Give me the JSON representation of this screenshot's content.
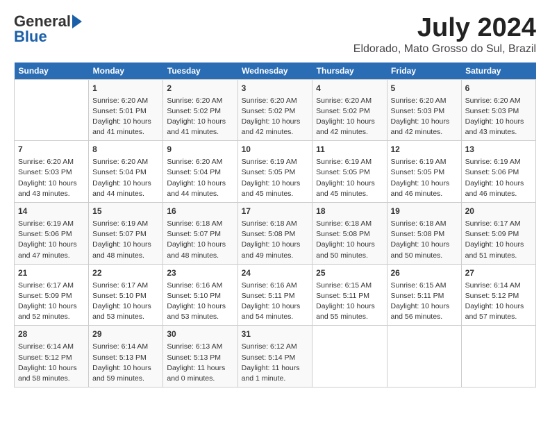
{
  "logo": {
    "general": "General",
    "blue": "Blue"
  },
  "title": {
    "month_year": "July 2024",
    "location": "Eldorado, Mato Grosso do Sul, Brazil"
  },
  "headers": [
    "Sunday",
    "Monday",
    "Tuesday",
    "Wednesday",
    "Thursday",
    "Friday",
    "Saturday"
  ],
  "weeks": [
    [
      {
        "day": "",
        "sunrise": "",
        "sunset": "",
        "daylight": ""
      },
      {
        "day": "1",
        "sunrise": "Sunrise: 6:20 AM",
        "sunset": "Sunset: 5:01 PM",
        "daylight": "Daylight: 10 hours and 41 minutes."
      },
      {
        "day": "2",
        "sunrise": "Sunrise: 6:20 AM",
        "sunset": "Sunset: 5:02 PM",
        "daylight": "Daylight: 10 hours and 41 minutes."
      },
      {
        "day": "3",
        "sunrise": "Sunrise: 6:20 AM",
        "sunset": "Sunset: 5:02 PM",
        "daylight": "Daylight: 10 hours and 42 minutes."
      },
      {
        "day": "4",
        "sunrise": "Sunrise: 6:20 AM",
        "sunset": "Sunset: 5:02 PM",
        "daylight": "Daylight: 10 hours and 42 minutes."
      },
      {
        "day": "5",
        "sunrise": "Sunrise: 6:20 AM",
        "sunset": "Sunset: 5:03 PM",
        "daylight": "Daylight: 10 hours and 42 minutes."
      },
      {
        "day": "6",
        "sunrise": "Sunrise: 6:20 AM",
        "sunset": "Sunset: 5:03 PM",
        "daylight": "Daylight: 10 hours and 43 minutes."
      }
    ],
    [
      {
        "day": "7",
        "sunrise": "Sunrise: 6:20 AM",
        "sunset": "Sunset: 5:03 PM",
        "daylight": "Daylight: 10 hours and 43 minutes."
      },
      {
        "day": "8",
        "sunrise": "Sunrise: 6:20 AM",
        "sunset": "Sunset: 5:04 PM",
        "daylight": "Daylight: 10 hours and 44 minutes."
      },
      {
        "day": "9",
        "sunrise": "Sunrise: 6:20 AM",
        "sunset": "Sunset: 5:04 PM",
        "daylight": "Daylight: 10 hours and 44 minutes."
      },
      {
        "day": "10",
        "sunrise": "Sunrise: 6:19 AM",
        "sunset": "Sunset: 5:05 PM",
        "daylight": "Daylight: 10 hours and 45 minutes."
      },
      {
        "day": "11",
        "sunrise": "Sunrise: 6:19 AM",
        "sunset": "Sunset: 5:05 PM",
        "daylight": "Daylight: 10 hours and 45 minutes."
      },
      {
        "day": "12",
        "sunrise": "Sunrise: 6:19 AM",
        "sunset": "Sunset: 5:05 PM",
        "daylight": "Daylight: 10 hours and 46 minutes."
      },
      {
        "day": "13",
        "sunrise": "Sunrise: 6:19 AM",
        "sunset": "Sunset: 5:06 PM",
        "daylight": "Daylight: 10 hours and 46 minutes."
      }
    ],
    [
      {
        "day": "14",
        "sunrise": "Sunrise: 6:19 AM",
        "sunset": "Sunset: 5:06 PM",
        "daylight": "Daylight: 10 hours and 47 minutes."
      },
      {
        "day": "15",
        "sunrise": "Sunrise: 6:19 AM",
        "sunset": "Sunset: 5:07 PM",
        "daylight": "Daylight: 10 hours and 48 minutes."
      },
      {
        "day": "16",
        "sunrise": "Sunrise: 6:18 AM",
        "sunset": "Sunset: 5:07 PM",
        "daylight": "Daylight: 10 hours and 48 minutes."
      },
      {
        "day": "17",
        "sunrise": "Sunrise: 6:18 AM",
        "sunset": "Sunset: 5:08 PM",
        "daylight": "Daylight: 10 hours and 49 minutes."
      },
      {
        "day": "18",
        "sunrise": "Sunrise: 6:18 AM",
        "sunset": "Sunset: 5:08 PM",
        "daylight": "Daylight: 10 hours and 50 minutes."
      },
      {
        "day": "19",
        "sunrise": "Sunrise: 6:18 AM",
        "sunset": "Sunset: 5:08 PM",
        "daylight": "Daylight: 10 hours and 50 minutes."
      },
      {
        "day": "20",
        "sunrise": "Sunrise: 6:17 AM",
        "sunset": "Sunset: 5:09 PM",
        "daylight": "Daylight: 10 hours and 51 minutes."
      }
    ],
    [
      {
        "day": "21",
        "sunrise": "Sunrise: 6:17 AM",
        "sunset": "Sunset: 5:09 PM",
        "daylight": "Daylight: 10 hours and 52 minutes."
      },
      {
        "day": "22",
        "sunrise": "Sunrise: 6:17 AM",
        "sunset": "Sunset: 5:10 PM",
        "daylight": "Daylight: 10 hours and 53 minutes."
      },
      {
        "day": "23",
        "sunrise": "Sunrise: 6:16 AM",
        "sunset": "Sunset: 5:10 PM",
        "daylight": "Daylight: 10 hours and 53 minutes."
      },
      {
        "day": "24",
        "sunrise": "Sunrise: 6:16 AM",
        "sunset": "Sunset: 5:11 PM",
        "daylight": "Daylight: 10 hours and 54 minutes."
      },
      {
        "day": "25",
        "sunrise": "Sunrise: 6:15 AM",
        "sunset": "Sunset: 5:11 PM",
        "daylight": "Daylight: 10 hours and 55 minutes."
      },
      {
        "day": "26",
        "sunrise": "Sunrise: 6:15 AM",
        "sunset": "Sunset: 5:11 PM",
        "daylight": "Daylight: 10 hours and 56 minutes."
      },
      {
        "day": "27",
        "sunrise": "Sunrise: 6:14 AM",
        "sunset": "Sunset: 5:12 PM",
        "daylight": "Daylight: 10 hours and 57 minutes."
      }
    ],
    [
      {
        "day": "28",
        "sunrise": "Sunrise: 6:14 AM",
        "sunset": "Sunset: 5:12 PM",
        "daylight": "Daylight: 10 hours and 58 minutes."
      },
      {
        "day": "29",
        "sunrise": "Sunrise: 6:14 AM",
        "sunset": "Sunset: 5:13 PM",
        "daylight": "Daylight: 10 hours and 59 minutes."
      },
      {
        "day": "30",
        "sunrise": "Sunrise: 6:13 AM",
        "sunset": "Sunset: 5:13 PM",
        "daylight": "Daylight: 11 hours and 0 minutes."
      },
      {
        "day": "31",
        "sunrise": "Sunrise: 6:12 AM",
        "sunset": "Sunset: 5:14 PM",
        "daylight": "Daylight: 11 hours and 1 minute."
      },
      {
        "day": "",
        "sunrise": "",
        "sunset": "",
        "daylight": ""
      },
      {
        "day": "",
        "sunrise": "",
        "sunset": "",
        "daylight": ""
      },
      {
        "day": "",
        "sunrise": "",
        "sunset": "",
        "daylight": ""
      }
    ]
  ]
}
